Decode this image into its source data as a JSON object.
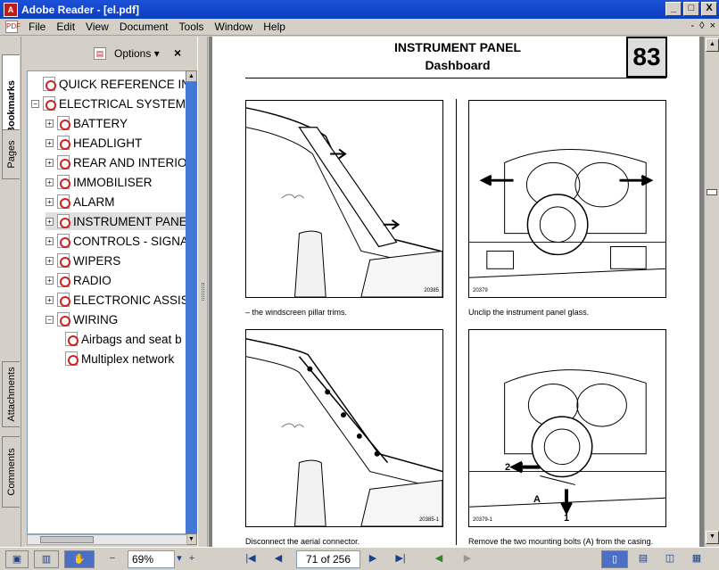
{
  "window": {
    "title": "Adobe Reader - [el.pdf]",
    "minimize": "_",
    "maximize": "□",
    "close": "X"
  },
  "menu": {
    "items": [
      "File",
      "Edit",
      "View",
      "Document",
      "Tools",
      "Window",
      "Help"
    ],
    "doc_controls": {
      "minimize": "-",
      "restore": "◊",
      "close": "×"
    }
  },
  "side_tabs": {
    "bookmarks": "Bookmarks",
    "pages": "Pages",
    "attachments": "Attachments",
    "comments": "Comments"
  },
  "bookmarks_panel": {
    "options_label": "Options",
    "close": "×"
  },
  "bookmarks": [
    {
      "label": "QUICK REFERENCE IN",
      "level": 0,
      "expander": ""
    },
    {
      "label": "ELECTRICAL SYSTEM",
      "level": 0,
      "expander": "−"
    },
    {
      "label": "BATTERY",
      "level": 1,
      "expander": "+"
    },
    {
      "label": "HEADLIGHT",
      "level": 1,
      "expander": "+"
    },
    {
      "label": "REAR AND INTERIO",
      "level": 1,
      "expander": "+"
    },
    {
      "label": "IMMOBILISER",
      "level": 1,
      "expander": "+"
    },
    {
      "label": "ALARM",
      "level": 1,
      "expander": "+"
    },
    {
      "label": "INSTRUMENT PANE",
      "level": 1,
      "expander": "+",
      "selected": true
    },
    {
      "label": "CONTROLS - SIGNA",
      "level": 1,
      "expander": "+"
    },
    {
      "label": "WIPERS",
      "level": 1,
      "expander": "+"
    },
    {
      "label": "RADIO",
      "level": 1,
      "expander": "+"
    },
    {
      "label": "ELECTRONIC ASSIS",
      "level": 1,
      "expander": "+"
    },
    {
      "label": "WIRING",
      "level": 1,
      "expander": "−"
    },
    {
      "label": "Airbags and seat b",
      "level": 2,
      "expander": ""
    },
    {
      "label": "Multiplex network",
      "level": 2,
      "expander": ""
    }
  ],
  "page": {
    "title": "INSTRUMENT PANEL",
    "subtitle": "Dashboard",
    "number": "83",
    "figures": [
      {
        "id": "20385",
        "caption": "– the windscreen pillar trims."
      },
      {
        "id": "20379",
        "caption": "Unclip the instrument panel glass."
      },
      {
        "id": "20385-1",
        "caption": "Disconnect the aerial connector."
      },
      {
        "id": "20379-1",
        "caption": "Remove the two mounting bolts (A) from the casing."
      }
    ],
    "callouts": {
      "a": "A",
      "one": "1",
      "two": "2"
    }
  },
  "statusbar": {
    "zoom": "69%",
    "page_indicator": "71 of 256",
    "zoom_out": "−",
    "zoom_in": "+",
    "first_page": "|◀",
    "prev_page": "◀",
    "next_page": "▶",
    "last_page": "▶|"
  }
}
